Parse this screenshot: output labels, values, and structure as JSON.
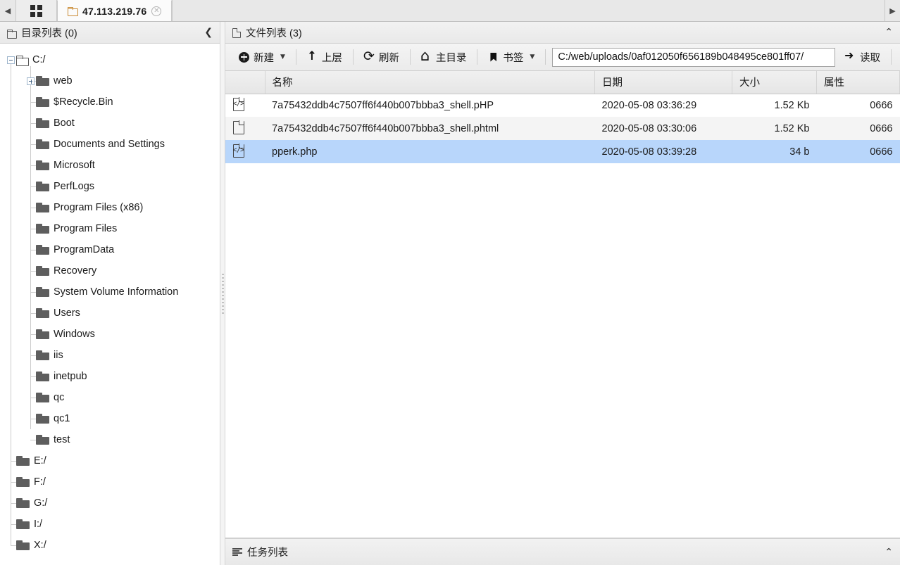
{
  "tabbar": {
    "scroll_left": "◀",
    "scroll_right": "▶",
    "grid_tab_name": "dashboard-tab",
    "tabs": [
      {
        "label": "47.113.219.76",
        "active": true,
        "close": "✕"
      }
    ]
  },
  "left_panel": {
    "title": "目录列表 (0)",
    "collapse_chevron": "❮",
    "tree": [
      {
        "label": "C:/",
        "depth": 0,
        "toggle": "minus",
        "icon": "folder-open"
      },
      {
        "label": "web",
        "depth": 1,
        "toggle": "plus",
        "icon": "folder-solid"
      },
      {
        "label": "$Recycle.Bin",
        "depth": 1,
        "toggle": "none",
        "icon": "folder-solid"
      },
      {
        "label": "Boot",
        "depth": 1,
        "toggle": "none",
        "icon": "folder-solid"
      },
      {
        "label": "Documents and Settings",
        "depth": 1,
        "toggle": "none",
        "icon": "folder-solid"
      },
      {
        "label": "Microsoft",
        "depth": 1,
        "toggle": "none",
        "icon": "folder-solid"
      },
      {
        "label": "PerfLogs",
        "depth": 1,
        "toggle": "none",
        "icon": "folder-solid"
      },
      {
        "label": "Program Files (x86)",
        "depth": 1,
        "toggle": "none",
        "icon": "folder-solid"
      },
      {
        "label": "Program Files",
        "depth": 1,
        "toggle": "none",
        "icon": "folder-solid"
      },
      {
        "label": "ProgramData",
        "depth": 1,
        "toggle": "none",
        "icon": "folder-solid"
      },
      {
        "label": "Recovery",
        "depth": 1,
        "toggle": "none",
        "icon": "folder-solid"
      },
      {
        "label": "System Volume Information",
        "depth": 1,
        "toggle": "none",
        "icon": "folder-solid"
      },
      {
        "label": "Users",
        "depth": 1,
        "toggle": "none",
        "icon": "folder-solid"
      },
      {
        "label": "Windows",
        "depth": 1,
        "toggle": "none",
        "icon": "folder-solid"
      },
      {
        "label": "iis",
        "depth": 1,
        "toggle": "none",
        "icon": "folder-solid"
      },
      {
        "label": "inetpub",
        "depth": 1,
        "toggle": "none",
        "icon": "folder-solid"
      },
      {
        "label": "qc",
        "depth": 1,
        "toggle": "none",
        "icon": "folder-solid"
      },
      {
        "label": "qc1",
        "depth": 1,
        "toggle": "none",
        "icon": "folder-solid"
      },
      {
        "label": "test",
        "depth": 1,
        "toggle": "none",
        "icon": "folder-solid"
      },
      {
        "label": "E:/",
        "depth": 0,
        "toggle": "none",
        "icon": "folder-solid"
      },
      {
        "label": "F:/",
        "depth": 0,
        "toggle": "none",
        "icon": "folder-solid"
      },
      {
        "label": "G:/",
        "depth": 0,
        "toggle": "none",
        "icon": "folder-solid"
      },
      {
        "label": "I:/",
        "depth": 0,
        "toggle": "none",
        "icon": "folder-solid"
      },
      {
        "label": "X:/",
        "depth": 0,
        "toggle": "none",
        "icon": "folder-solid"
      }
    ]
  },
  "right_panel": {
    "title": "文件列表 (3)",
    "collapse_chevron": "⌃",
    "toolbar": {
      "new_label": "新建",
      "new_caret": "▼",
      "up_label": "上层",
      "refresh_label": "刷新",
      "home_label": "主目录",
      "bookmark_label": "书签",
      "bookmark_caret": "▼",
      "read_label": "读取"
    },
    "address": {
      "value": "C:/web/uploads/0af012050f656189b048495ce801ff07/",
      "placeholder": "路径"
    },
    "table": {
      "columns": [
        "",
        "名称",
        "日期",
        "大小",
        "属性"
      ],
      "rows": [
        {
          "icon": "php-file-icon",
          "name": "7a75432ddb4c7507ff6f440b007bbba3_shell.pHP",
          "date": "2020-05-08 03:36:29",
          "size": "1.52 Kb",
          "attr": "0666",
          "selected": false
        },
        {
          "icon": "plain-file-icon",
          "name": "7a75432ddb4c7507ff6f440b007bbba3_shell.phtml",
          "date": "2020-05-08 03:30:06",
          "size": "1.52 Kb",
          "attr": "0666",
          "selected": false
        },
        {
          "icon": "php-file-icon",
          "name": "pperk.php",
          "date": "2020-05-08 03:39:28",
          "size": "34 b",
          "attr": "0666",
          "selected": true
        }
      ]
    }
  },
  "taskbar": {
    "title": "任务列表",
    "collapse_chevron": "⌃"
  },
  "colors": {
    "selection": "#b8d6fb",
    "tab_accent": "#c98a32",
    "panel_bg": "#ececec"
  }
}
